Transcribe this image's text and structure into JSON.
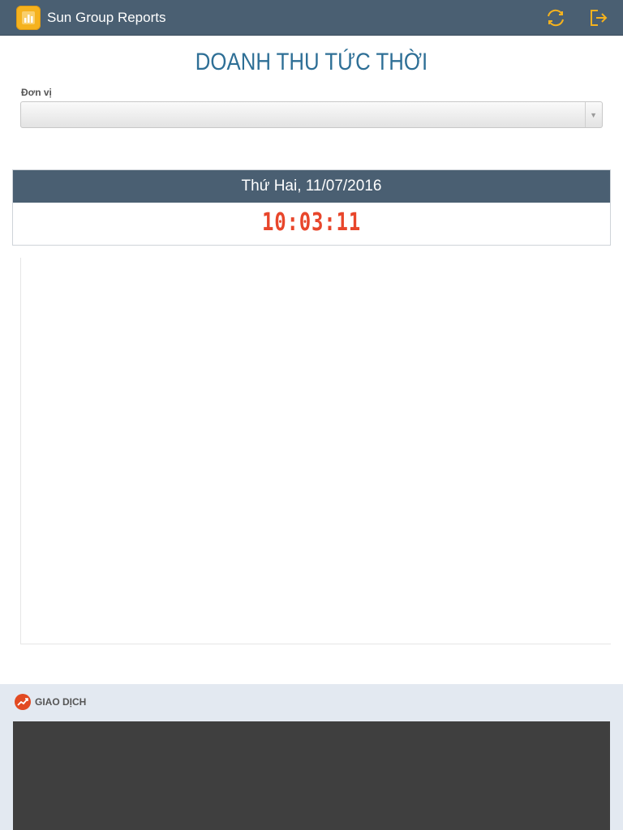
{
  "header": {
    "app_title": "Sun Group Reports",
    "app_icon": "bar-chart-icon",
    "refresh_icon": "refresh-icon",
    "logout_icon": "logout-icon",
    "accent_color": "#f5b21e"
  },
  "page": {
    "title": "DOANH THU TỨC THỜI",
    "title_color": "#2e6f96"
  },
  "filter": {
    "unit_label": "Đơn vị",
    "unit_value": ""
  },
  "clock": {
    "date": "Thứ Hai, 11/07/2016",
    "time": "10:03:11",
    "time_color": "#e8462b"
  },
  "section": {
    "title": "GIAO DỊCH",
    "icon": "trend-chart-icon",
    "icon_color": "#e24a22"
  }
}
